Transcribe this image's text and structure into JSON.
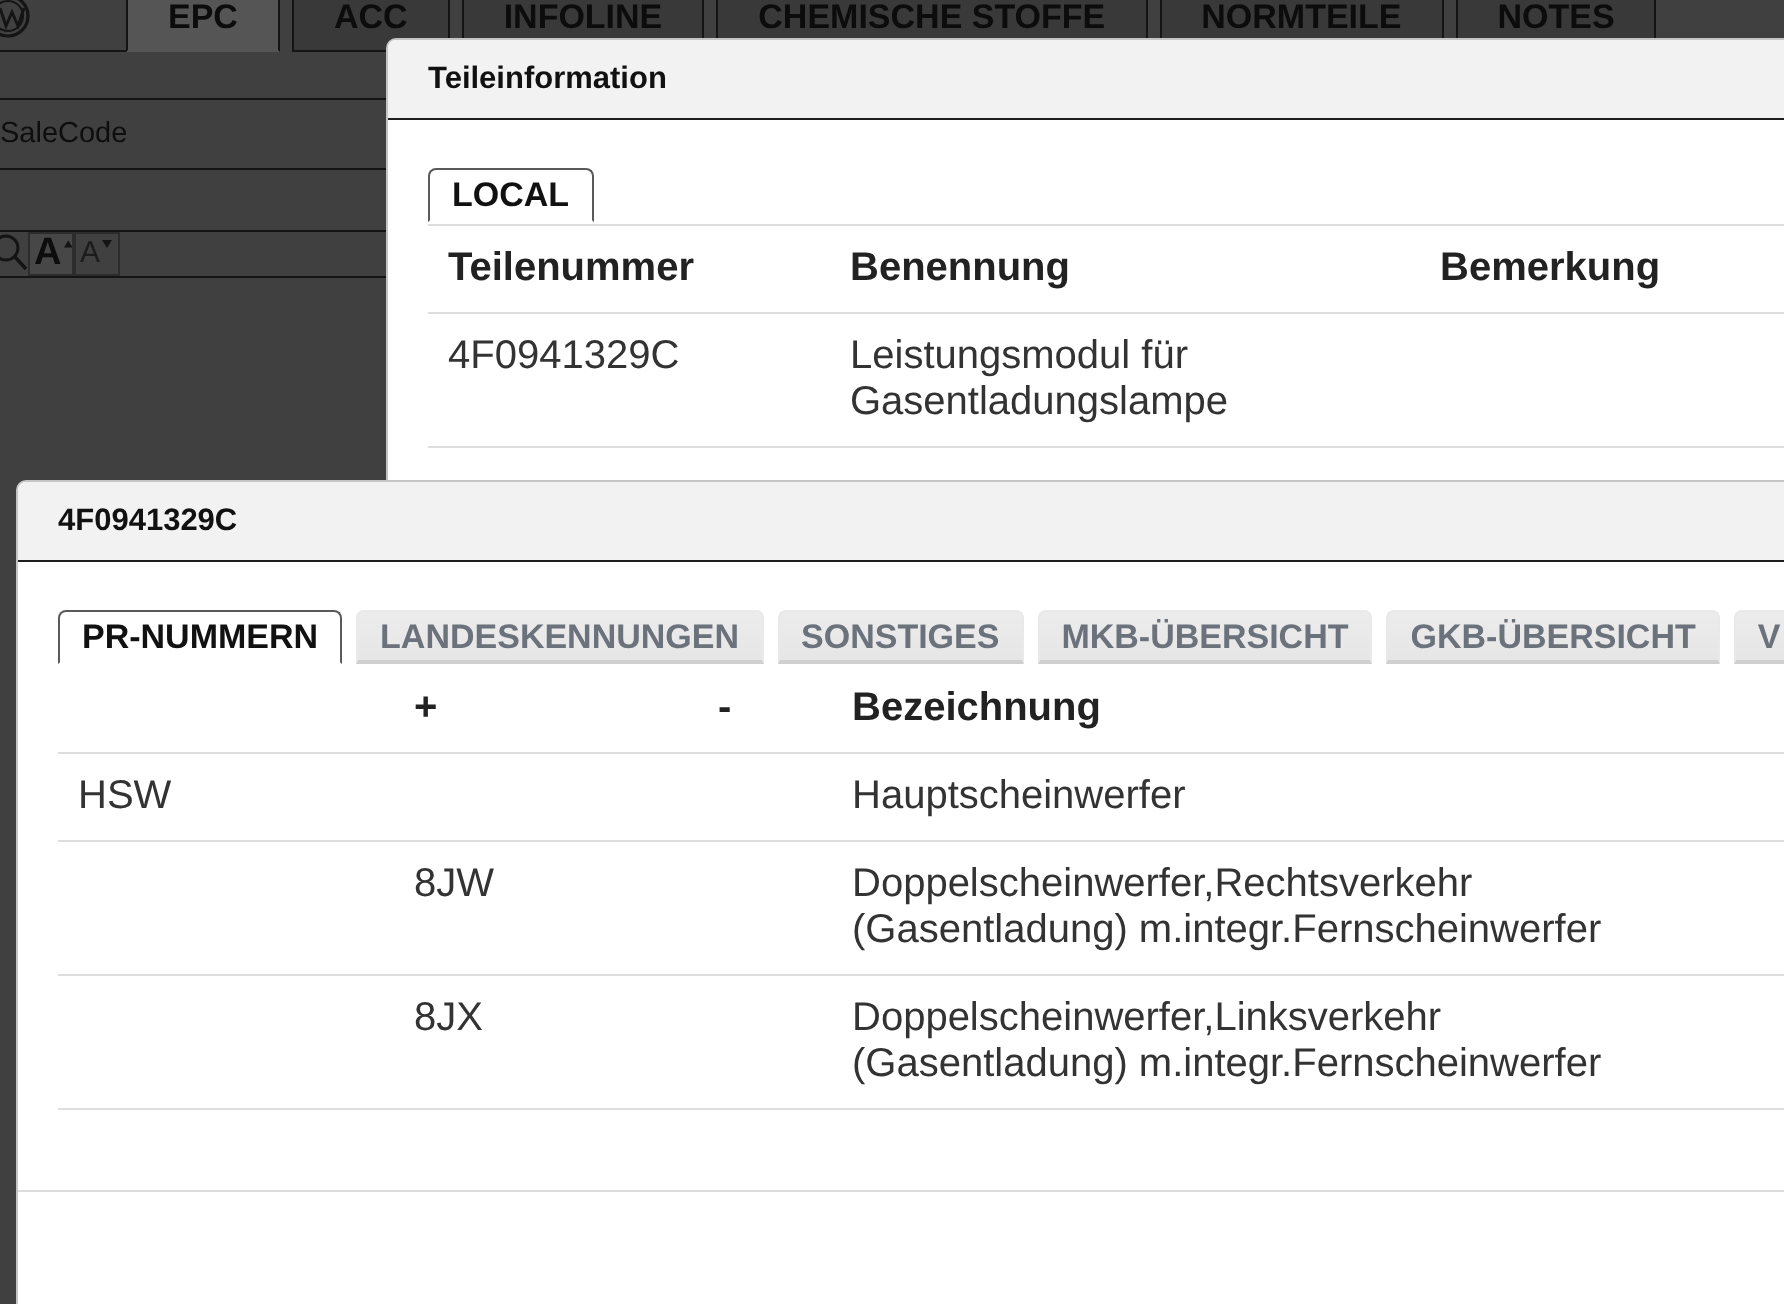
{
  "app": {
    "tabs": [
      {
        "label": "EPC",
        "selected": true
      },
      {
        "label": "ACC",
        "selected": false
      },
      {
        "label": "INFOLINE",
        "selected": false
      },
      {
        "label": "CHEMISCHE STOFFE",
        "selected": false
      },
      {
        "label": "NORMTEILE",
        "selected": false
      },
      {
        "label": "NOTES",
        "selected": false
      }
    ],
    "sale_code_field": {
      "placeholder": "SaleCode"
    },
    "font_buttons": [
      {
        "label": "A",
        "kind": "increase"
      },
      {
        "label": "A",
        "kind": "decrease"
      }
    ]
  },
  "part_info_dialog": {
    "title": "Teileinformation",
    "tabs": [
      {
        "label": "LOCAL",
        "selected": true
      }
    ],
    "table": {
      "header": {
        "part_number": "Teilenummer",
        "name": "Benennung",
        "remark": "Bemerkung"
      },
      "rows": [
        {
          "part_number": "4F0941329C",
          "name": "Leistungsmodul für Gasentladungslampe"
        }
      ]
    }
  },
  "pr_dialog": {
    "title": "4F0941329C",
    "tabs": [
      {
        "label": "PR-NUMMERN",
        "selected": true
      },
      {
        "label": "LANDESKENNUNGEN",
        "selected": false
      },
      {
        "label": "SONSTIGES",
        "selected": false
      },
      {
        "label": "MKB-ÜBERSICHT",
        "selected": false
      },
      {
        "label": "GKB-ÜBERSICHT",
        "selected": false
      },
      {
        "label": "V",
        "selected": false
      }
    ],
    "table": {
      "header": {
        "plus": "+",
        "minus": "-",
        "description": "Bezeichnung"
      },
      "rows": [
        {
          "column_1": "HSW",
          "description": "Hauptscheinwerfer"
        },
        {
          "plus": "8JW",
          "description": "Doppelscheinwerfer,Rechtsverkehr (Gasentladung) m.integr.Fernscheinwerfer"
        },
        {
          "plus": "8JX",
          "description": "Doppelscheinwerfer,Linksverkehr (Gasentladung) m.integr.Fernscheinwerfer"
        }
      ]
    }
  }
}
